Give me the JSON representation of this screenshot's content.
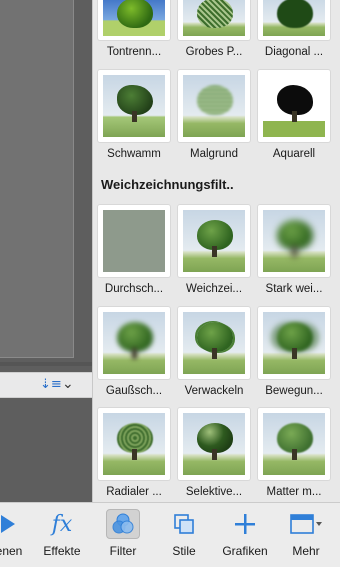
{
  "filter_rows_top": [
    {
      "label": "Tontrenn..."
    },
    {
      "label": "Grobes P..."
    },
    {
      "label": "Diagonal ..."
    }
  ],
  "filter_rows_artistic": [
    {
      "label": "Schwamm"
    },
    {
      "label": "Malgrund"
    },
    {
      "label": "Aquarell"
    }
  ],
  "section": {
    "title": "Weichzeichnungsfilt.."
  },
  "blur_filters": [
    {
      "label": "Durchsch..."
    },
    {
      "label": "Weichzei..."
    },
    {
      "label": "Stark wei..."
    },
    {
      "label": "Gaußsch..."
    },
    {
      "label": "Verwackeln"
    },
    {
      "label": "Bewegun..."
    },
    {
      "label": "Radialer ..."
    },
    {
      "label": "Selektive..."
    },
    {
      "label": "Matter m..."
    }
  ],
  "dock": {
    "items": [
      {
        "label": "enen",
        "icon": "adjust-icon"
      },
      {
        "label": "Effekte",
        "icon": "fx-icon"
      },
      {
        "label": "Filter",
        "icon": "filter-icon"
      },
      {
        "label": "Stile",
        "icon": "styles-icon"
      },
      {
        "label": "Grafiken",
        "icon": "plus-icon"
      },
      {
        "label": "Mehr",
        "icon": "more-icon"
      }
    ]
  },
  "colors": {
    "accent": "#2f7fd8",
    "panel_bg": "#e8e8e8",
    "dock_bg": "#ececec"
  }
}
